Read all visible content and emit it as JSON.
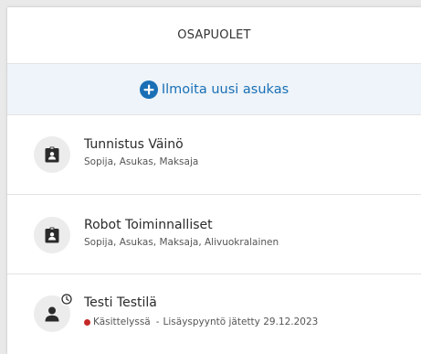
{
  "panel": {
    "title": "OSAPUOLET"
  },
  "add_resident": {
    "label": "Ilmoita uusi asukas",
    "icon": "plus-circle-icon",
    "color": "#1a6fb5"
  },
  "parties": [
    {
      "name": "Tunnistus Väinö",
      "roles": "Sopija, Asukas, Maksaja",
      "icon": "id-badge-icon"
    },
    {
      "name": "Robot Toiminnalliset",
      "roles": "Sopija, Asukas, Maksaja, Alivuokralainen",
      "icon": "id-badge-icon"
    },
    {
      "name": "Testi Testilä",
      "icon": "person-pending-icon",
      "status": {
        "label": "Käsittelyssä",
        "separator": "-",
        "detail": "Lisäyspyyntö jätetty 29.12.2023",
        "color": "#c62828"
      }
    }
  ]
}
